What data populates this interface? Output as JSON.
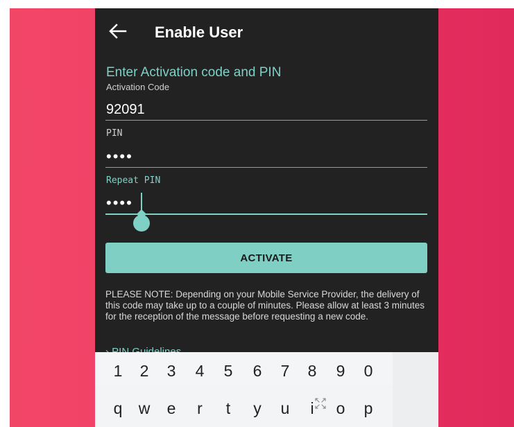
{
  "app": {
    "title": "Enable User",
    "back_label": "Back"
  },
  "form": {
    "heading": "Enter Activation code and PIN",
    "activation_code": {
      "label": "Activation Code",
      "value": "92091"
    },
    "pin": {
      "label": "PIN",
      "masked_value": "••••"
    },
    "repeat_pin": {
      "label": "Repeat PIN",
      "masked_value": "••••"
    },
    "activate_label": "ACTIVATE",
    "note": "PLEASE NOTE: Depending on your Mobile Service Provider, the delivery of this code may take up to a couple of minutes. Please allow at least 3 minutes for the reception of the message before requesting a new code.",
    "guidelines_label": "› PIN Guidelines"
  },
  "keyboard": {
    "number_keys": [
      "1",
      "2",
      "3",
      "4",
      "5",
      "6",
      "7",
      "8",
      "9",
      "0"
    ],
    "letter_keys": [
      "q",
      "w",
      "e",
      "r",
      "t",
      "y",
      "u",
      "i",
      "o",
      "p"
    ],
    "expand_icon": "expand-arrows-icon"
  },
  "colors": {
    "accent": "#7fd0c5",
    "background_gradient_start": "#f24667",
    "background_gradient_end": "#df2a5b",
    "app_background": "#222222"
  }
}
